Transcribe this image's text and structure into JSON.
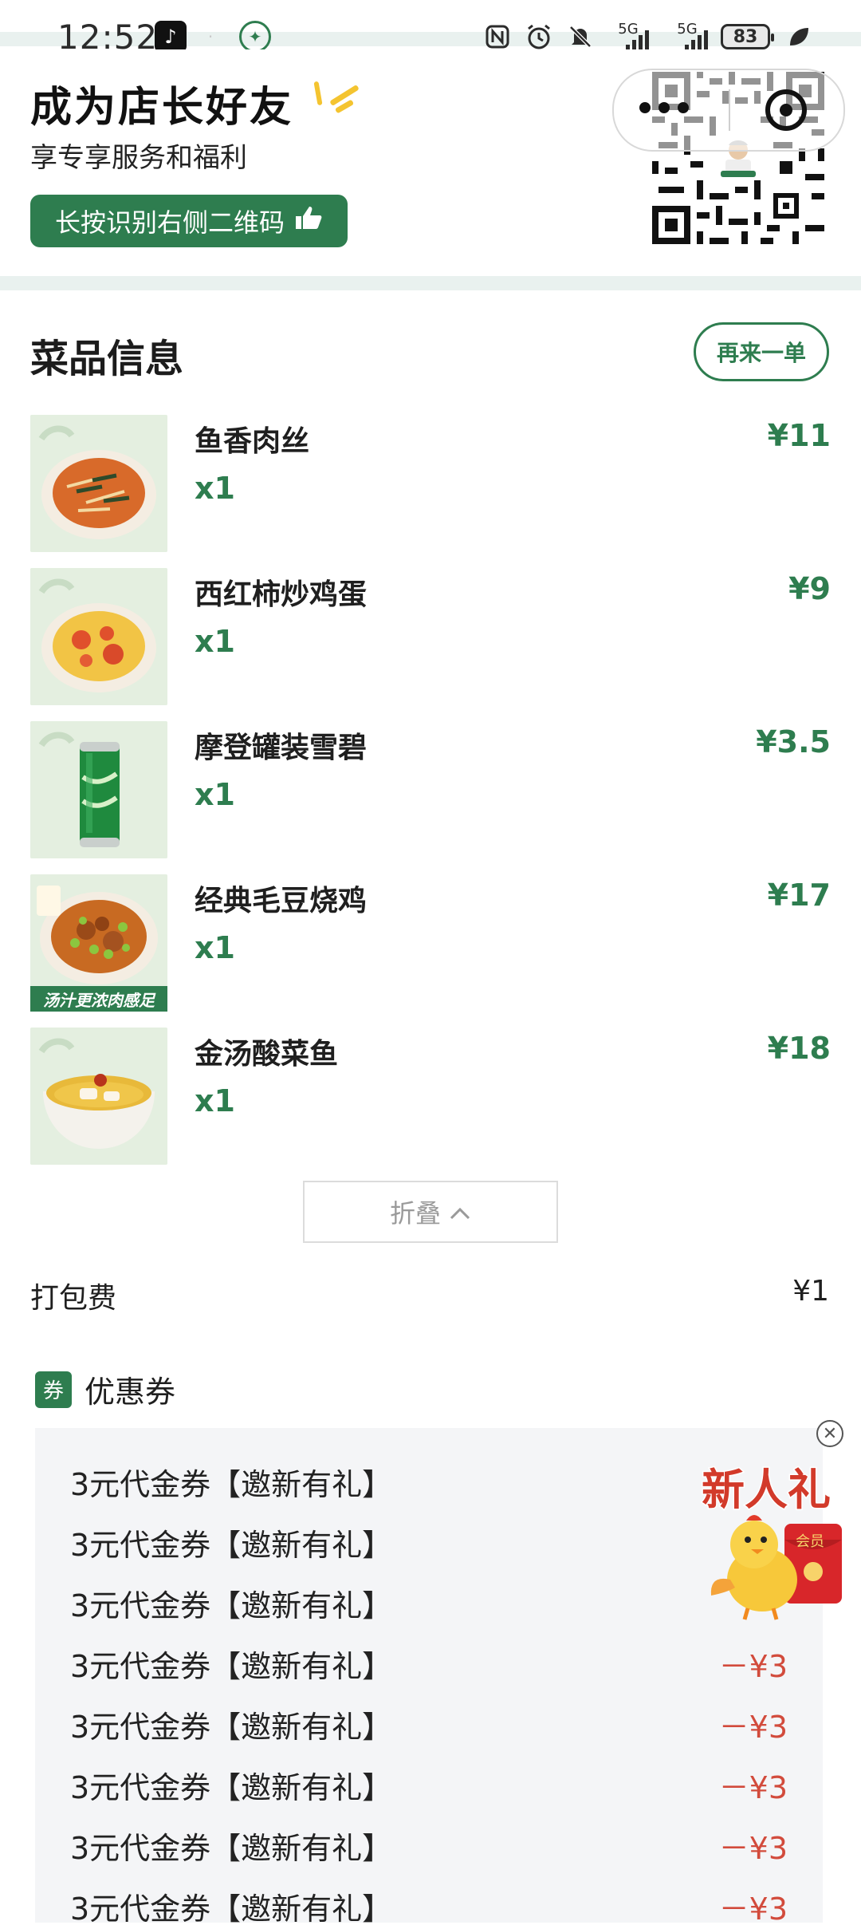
{
  "status_bar": {
    "time": "12:52",
    "net1": "5G",
    "net2": "5G",
    "battery": "83"
  },
  "friend_banner": {
    "title": "成为店长好友",
    "subtitle": "享专享服务和福利",
    "button_label": "长按识别右侧二维码"
  },
  "dishes_section": {
    "title": "菜品信息",
    "reorder_label": "再来一单",
    "items": [
      {
        "name": "鱼香肉丝",
        "qty": "x1",
        "price": "¥11"
      },
      {
        "name": "西红柿炒鸡蛋",
        "qty": "x1",
        "price": "¥9"
      },
      {
        "name": "摩登罐装雪碧",
        "qty": "x1",
        "price": "¥3.5"
      },
      {
        "name": "经典毛豆烧鸡",
        "qty": "x1",
        "price": "¥17",
        "badge": "汤汁更浓肉感足"
      },
      {
        "name": "金汤酸菜鱼",
        "qty": "x1",
        "price": "¥18"
      }
    ],
    "collapse_label": "折叠"
  },
  "packing": {
    "label": "打包费",
    "value": "¥1"
  },
  "coupons": {
    "badge": "券",
    "title": "优惠券",
    "items": [
      {
        "name": "3元代金券【邀新有礼】",
        "amount": ""
      },
      {
        "name": "3元代金券【邀新有礼】",
        "amount": ""
      },
      {
        "name": "3元代金券【邀新有礼】",
        "amount": ""
      },
      {
        "name": "3元代金券【邀新有礼】",
        "amount": "－¥3"
      },
      {
        "name": "3元代金券【邀新有礼】",
        "amount": "－¥3"
      },
      {
        "name": "3元代金券【邀新有礼】",
        "amount": "－¥3"
      },
      {
        "name": "3元代金券【邀新有礼】",
        "amount": "－¥3"
      },
      {
        "name": "3元代金券【邀新有礼】",
        "amount": "－¥3"
      }
    ]
  },
  "gift_popup": {
    "title": "新人礼",
    "envelope_text": "会员"
  },
  "colors": {
    "brand_green": "#2e7d4f",
    "discount_red": "#d24b3c"
  }
}
